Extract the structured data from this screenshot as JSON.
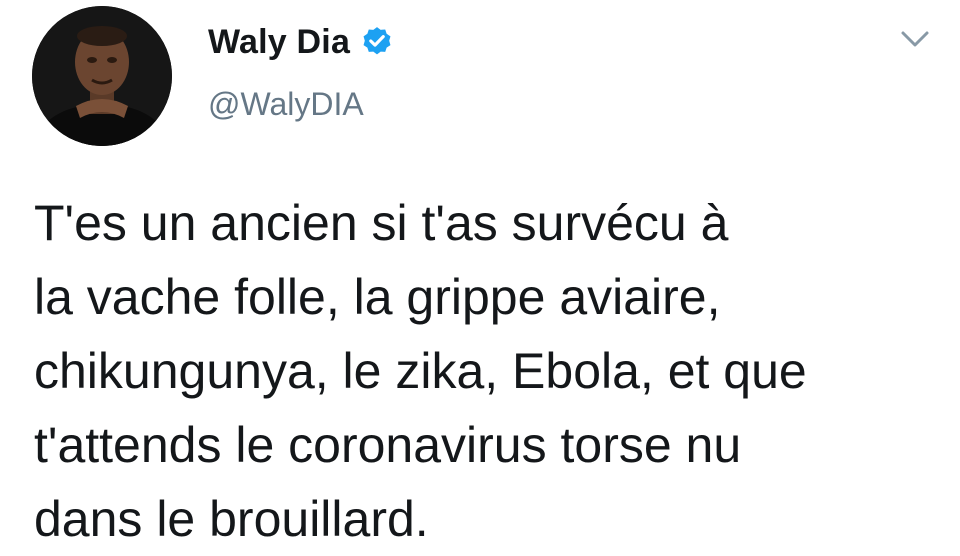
{
  "author": {
    "display_name": "Waly Dia",
    "handle": "@WalyDIA",
    "verified_icon": "verified-badge-icon",
    "avatar": "profile-photo"
  },
  "menu": {
    "icon": "chevron-down-icon"
  },
  "tweet": {
    "lines": [
      "T'es un ancien si t'as survécu à",
      "la vache folle, la grippe aviaire,",
      "chikungunya, le zika, Ebola, et que",
      "t'attends le coronavirus torse nu",
      "dans le brouillard."
    ]
  },
  "colors": {
    "verified": "#1da1f2",
    "handle": "#657786",
    "text": "#14171a",
    "chevron": "#8899a6"
  }
}
